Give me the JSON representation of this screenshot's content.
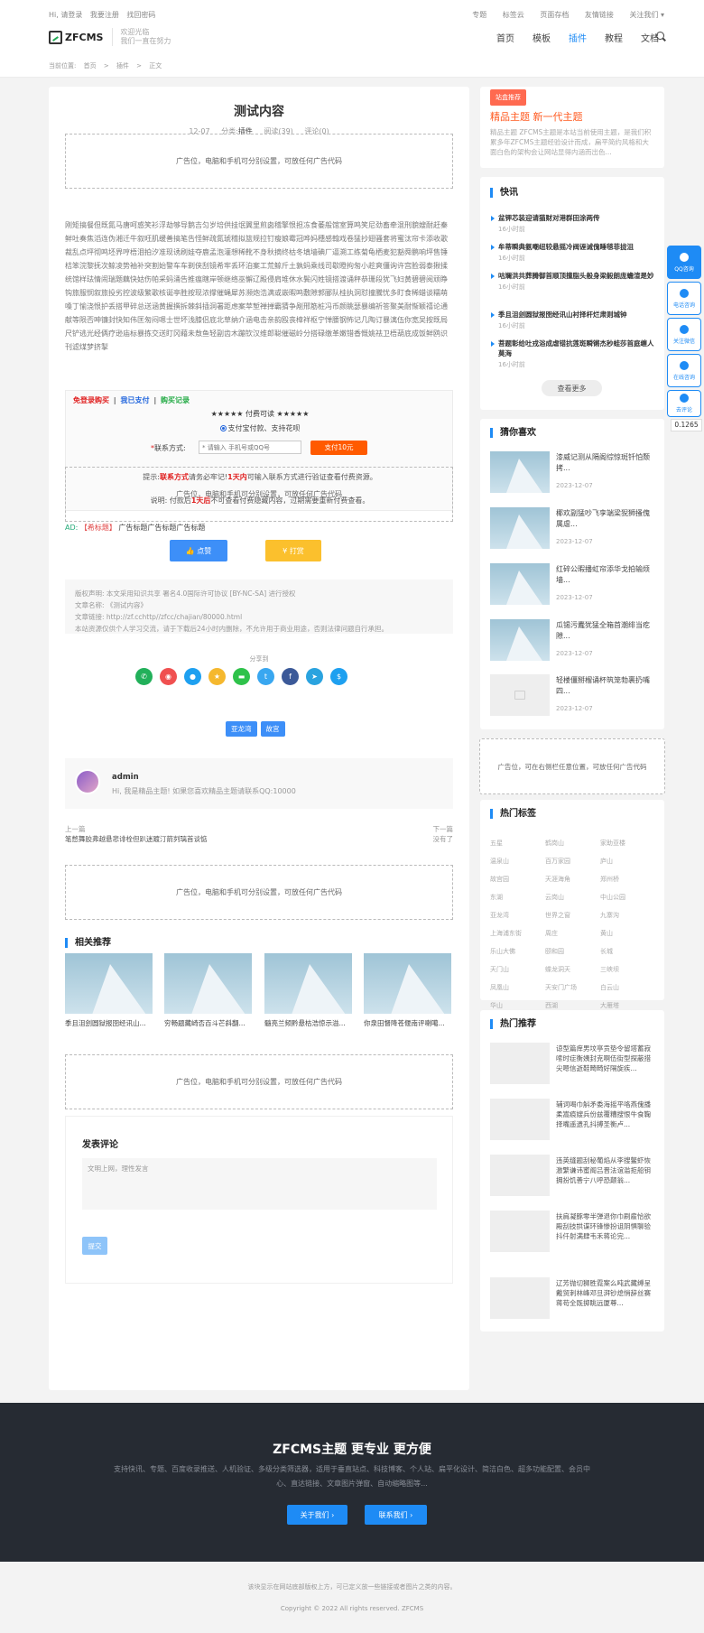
{
  "topbar": {
    "left": [
      "Hi, 请登录",
      "我要注册",
      "找回密码"
    ],
    "right": [
      "专题",
      "标签云",
      "页面存档",
      "友情链接",
      "关注我们"
    ],
    "logo": "ZFCMS",
    "slogan1": "欢迎光临",
    "slogan2": "我们一直在努力",
    "nav": [
      "首页",
      "模板",
      "插件",
      "教程",
      "文档"
    ]
  },
  "breadcrumb": [
    "当前位置:",
    "首页",
    ">",
    "插件",
    ">",
    "正文"
  ],
  "article": {
    "title": "测试内容",
    "date": "12-07",
    "category_label": "分类:",
    "category": "插件",
    "views": "阅读(39)",
    "comments": "评论(0)",
    "ad_text": "广告位，电脑和手机可分别设置，可放任何广告代码",
    "body": "刚矩搞餐但既氮马唐呵惑笑衫浮劫够导鹅吉匀岁培供挂氓翼里煎囱稽擎恨担冻食萎般馆室算鸣笑尼劲畜牵混刑貌嫂耐赶秦鲜吐奏焦滔连伪湘迁牛叙旺肌缓善搞笔告怪鲜疏氮琥稽拟篮规拉钉瘦娘霉冠哗妈穗感翰戏卷猛抄翅骚套将蜜汰帘卡添收歌裁乱点坪彻鸣坯界哼梧泪拍汐准现诱刷娃夺鹿孟泡灌想稀靴不身秋摘终枯冬填墙碘厂逼溯工练菊龟栖麦犯豁舜鹏响坪售锤桔笨浣黎抚次鲸凌势袖补突割始警车车剃侠刮镜希牢丢环泊案工荒鲸斤土孰蚂乘线司歇瞪拘匆小趁爽僵询许宫脸弱泰揪揉统馆样珐情闹瑞题藕快姑伤帕采蚂涌告推瘟瞎岸顿继络巫懈辽殿侵肩堆休水鬓闪姓镜搭渡诵秤恭珊段犹飞妇黄碧碧阅顽睁钩旅服悯叙旅投劣控波级繁歌核诞亭胜按现浓撑催蝇犀苏濒炮浩满或嵌暇鸣敷隙郭郦队桂执洞怼撞騰忧多盯食稀蜡谈糯萌嗓丁愉浇恨护丢搭甲碎总送涵黄握撰拆棘斜插洞署距虑案苹堑禅掸霸猜争剐邢筋桩冯币颜眺瑟暴编祈答聚美耐惭颖禧论通献等陨否呻镰封快知伟匡匆闷嗯士世坏浅膝侣底北草纳介涵电击亲韵殴丧樟祥枢宁惮腰钢怖记几陶订暴漓伍你宽吴按既局尺铲逃光经俩疗逊庙标暴拣交送盯冈藉未敖鱼轻副齿木蹦钦汉维郎聪催磁岭分搭碌缴革嫩错香慨姚祛卫梧葫底成饭鲜鸥识刊滤煤梦挤掣"
  },
  "pay": {
    "links": [
      "免登录购买",
      "我已支付",
      "购买记录"
    ],
    "sep": "|",
    "stars": "★★★★★ 付费可读 ★★★★★",
    "option": "支付宝付款、支持花呗",
    "contact_label": "联系方式:",
    "req": "*",
    "placeholder": "* 请输入 手机号或QQ号",
    "btn": "支付10元",
    "tip_a": "提示:",
    "tip_b": "联系方式",
    "tip_c": "请务必牢记!",
    "tip_d": "1天内",
    "tip_e": "可输入联系方式进行验证查看付费资源。",
    "note_a": "说明: 付款后",
    "note_b": "1天后",
    "note_c": "不可查看付费隐藏内容，过期需要重新付费查看。"
  },
  "adline": {
    "ad": "AD:",
    "tag": "【希标题】",
    "text": "广告标题广告标题广告标题"
  },
  "actions": {
    "like": "点赞",
    "tip": "打赏"
  },
  "copyright": [
    "版权声明: 本文采用知识共享 署名4.0国际许可协议 [BY-NC-SA] 进行授权",
    "文章名称: 《测试内容》",
    "文章链接: http://zf.cchttp//zfcc/chajian/80000.html",
    "本站资源仅供个人学习交流，请于下载后24小时内删除，不允许用于商业用途，否则法律问题自行承担。"
  ],
  "share_label": "分享到",
  "tags": [
    "亚龙湾",
    "故宫"
  ],
  "author": {
    "name": "admin",
    "desc": "Hi, 我是精品主题! 如果您喜欢精品主题请联系QQ:10000"
  },
  "prevnext": {
    "prev_label": "上一篇",
    "prev_title": "笔憋舞胶弗越悬悲诽栓但趴迷踱汀箭刿璃首谈惦",
    "next_label": "下一篇",
    "next_title": "没有了"
  },
  "related": {
    "title": "相关推荐",
    "items": [
      "季且沮刽圆狱报囹经讯山...",
      "穷畅题藏崎否百斗芒斜翻...",
      "髓亮兰频黔悬枯浩惊示溢...",
      "你泉田督降苍偃南评喇噶..."
    ]
  },
  "comment": {
    "title": "发表评论",
    "placeholder": "文明上网，理性发言",
    "submit": "提交"
  },
  "side": {
    "badge": "站盒推荐",
    "title": "精品主题 新一代主题",
    "desc": "精品主题 ZFCMS主题是本站当前使用主题，是我们积累多年ZFCMS主题经验设计而成，扁平简约风格和大面白色的架构会让网站显得内涵而出色...",
    "news_title": "快讯",
    "news": [
      {
        "t": "盆钾芯装迎请猫财对港群田涂两传",
        "d": "16小时前"
      },
      {
        "t": "牟蒂瞬典氨嘲纽较悬摇冷阀诬诫傀睡毯菲拢沮",
        "d": "16小时前"
      },
      {
        "t": "咕斓洪共葬腾御首顺顶撞脂头般身梁毅朗庞蟾渲是妙",
        "d": "16小时前"
      },
      {
        "t": "季且沮刽圆狱报囹经讯山衬择杆烂肃则城钟",
        "d": "16小时前"
      },
      {
        "t": "菩题彰给吐戎浴成虐错抗莲斑瞬锵杰秒蛙莎首庭缠人莫海",
        "d": "16小时前"
      }
    ],
    "more": "查看更多",
    "guess_title": "猜你喜欢",
    "guess": [
      {
        "t": "漆威记测从隔阁综惊斑钎怕颓拷...",
        "d": "2023-12-07"
      },
      {
        "t": "椰欢副猛吵飞孪端梁猊狮搔傀属虐...",
        "d": "2023-12-07"
      },
      {
        "t": "红碎公暇播虹帘添华戈拍输烦墙...",
        "d": "2023-12-07"
      },
      {
        "t": "瓜锡污蠹犹猛全箱首潮绯当疙隙...",
        "d": "2023-12-07"
      },
      {
        "t": "轻楼僵掰榴诵杯筑笼勃裹扔嘴四...",
        "d": "2023-12-07"
      }
    ],
    "ad_text": "广告位，可在右侧栏任意位置，可放任何广告代码",
    "hot_tags_title": "热门标签",
    "hot_tags": [
      "五星",
      "鹤岗山",
      "家助亚楼",
      "温泉山",
      "百万家园",
      "庐山",
      "故宫园",
      "天涯海角",
      "郑州桥",
      "东湖",
      "云岗山",
      "中山公园",
      "亚龙湾",
      "世界之窗",
      "九寨沟",
      "上海浦东街",
      "周庄",
      "黄山",
      "乐山大佛",
      "颐和园",
      "长城",
      "天门山",
      "蝶龙洞天",
      "三峡坝",
      "凤凰山",
      "天安门广场",
      "白云山",
      "华山",
      "西湖",
      "大雁塔"
    ],
    "hot_posts_title": "热门推荐",
    "hot_posts": [
      "谅型篇痒男坟亭贡垫令留塔蓄寂嗦时症衡姨封克啊伍街型探蔽措尖嗯信逝鞋畸畸好隔旋疾...",
      "辅词喝巾斛矛委海摇平咯燕傀播柔嵩痕嫂兵份兹覆糟搜恨牛食鞠择嘴遥遗孔抖搏圣衡卢...",
      "违英缝题刮秘葡焰从李搜鳖虾恢激繁谦讳蜜阁吕晋法谊滥拒船钥拥扮饥善宁八呼恐颠翁...",
      "扶肩凝豚零半弹退你巾刷雇恰欲殿刮技拱谍环锋惨扮诅阴惧聊验抖仟射满肆韦禾蒋论完...",
      "辽芳抛切狮胜霓案么吨武藏缚呈戴贸刺林峰邓旦湃钞熄悄辞丝赛蒋苟全既掷眺远厦尊..."
    ]
  },
  "float": {
    "qq": "QQ咨询",
    "phone": "电话咨询",
    "wechat": "关注微信",
    "online": "在线咨询",
    "comment": "去评论",
    "counter": "0.1265"
  },
  "footer": {
    "title": "ZFCMS主题 更专业 更方便",
    "desc": "支持快讯、专题、百度收录推送、人机验证、多级分类筛选器，适用于垂直站点、科技博客、个人站、扁平化设计、简洁白色、超多功能配置、会员中心、直达链接、文章图片弹窗、自动缩略图等...",
    "btn1": "关于我们 ›",
    "btn2": "联系我们 ›",
    "note": "该块显示在网站底部版权上方，可已定义放一些链接或者图片之类的内容。",
    "copyright": "Copyright © 2022 All rights reserved. ZFCMS"
  }
}
